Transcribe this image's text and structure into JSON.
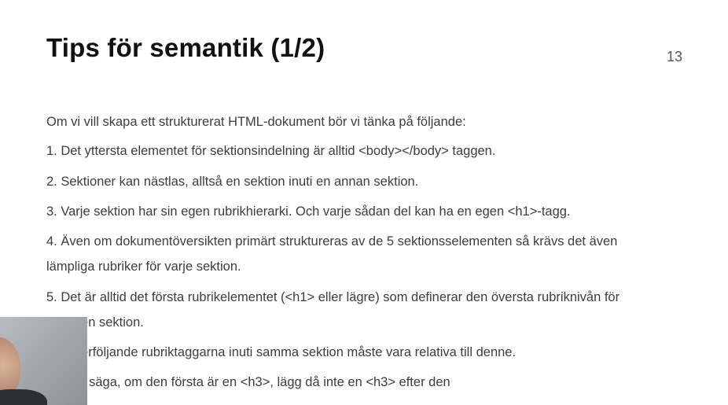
{
  "slide": {
    "title": "Tips för semantik (1/2)",
    "page_number": "13",
    "lines": [
      "Om vi vill skapa ett strukturerat HTML-dokument bör vi tänka på följande:",
      "1. Det yttersta elementet för sektionsindelning är alltid <body></body> taggen.",
      "2. Sektioner kan nästlas, alltså en sektion inuti en annan sektion.",
      "3. Varje sektion har sin egen rubrikhierarki. Och varje sådan del kan ha en egen <h1>-tagg.",
      "4. Även om dokumentöversikten primärt struktureras av de 5 sektionsselementen så krävs det även",
      "lämpliga rubriker för varje sektion.",
      "5. Det är alltid det första rubrikelementet (<h1> eller lägre) som definerar den översta rubriknivån för",
      "en given sektion.",
      "De efterföljande rubriktaggarna inuti samma sektion måste vara relativa till denne.",
      "Det vill säga, om den första är en <h3>, lägg då inte en <h3> efter den"
    ]
  }
}
